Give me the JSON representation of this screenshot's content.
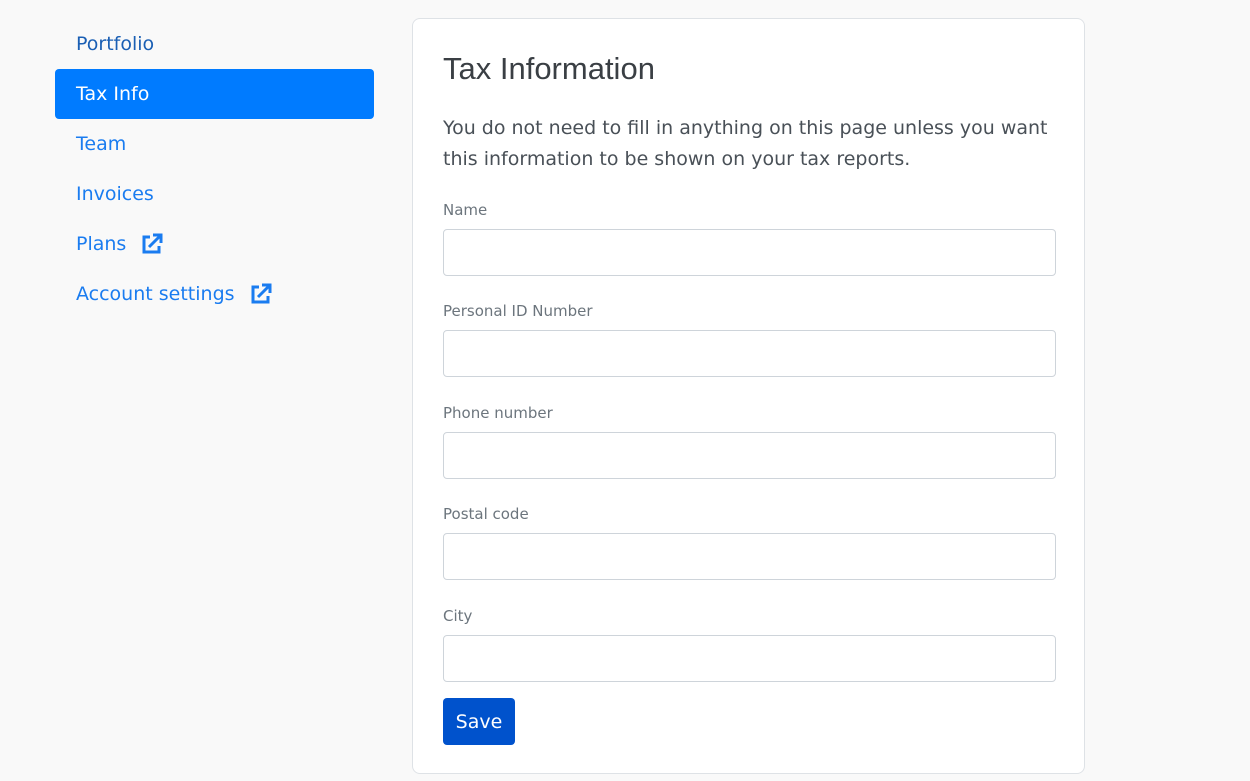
{
  "sidebar": {
    "items": [
      {
        "label": "Portfolio",
        "state": "visited",
        "external": false
      },
      {
        "label": "Tax Info",
        "state": "active",
        "external": false
      },
      {
        "label": "Team",
        "state": "default",
        "external": false
      },
      {
        "label": "Invoices",
        "state": "default",
        "external": false
      },
      {
        "label": "Plans",
        "state": "default",
        "external": true,
        "icon": "external-link-icon"
      },
      {
        "label": "Account settings",
        "state": "default",
        "external": true,
        "icon": "external-link-icon"
      }
    ]
  },
  "main": {
    "title": "Tax Information",
    "intro": "You do not need to fill in anything on this page unless you want this information to be shown on your tax reports.",
    "fields": [
      {
        "label": "Name",
        "value": "",
        "placeholder": ""
      },
      {
        "label": "Personal ID Number",
        "value": "",
        "placeholder": ""
      },
      {
        "label": "Phone number",
        "value": "",
        "placeholder": ""
      },
      {
        "label": "Postal code",
        "value": "",
        "placeholder": ""
      },
      {
        "label": "City",
        "value": "",
        "placeholder": ""
      }
    ],
    "save_label": "Save"
  },
  "colors": {
    "accent": "#007bff",
    "link": "#1a7cf0",
    "save_button": "#0052cc"
  }
}
